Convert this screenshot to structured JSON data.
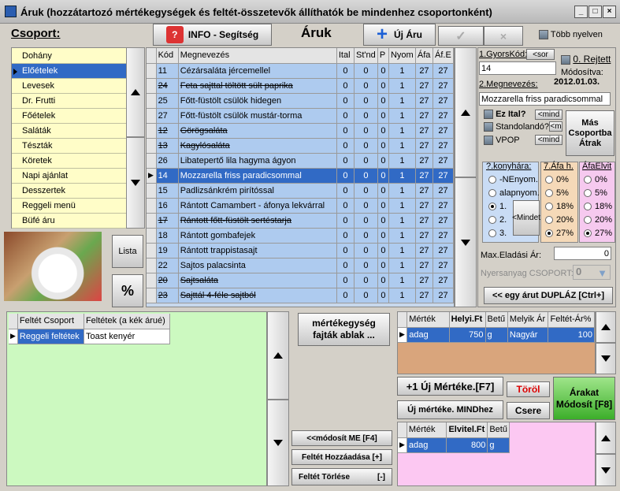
{
  "title": "Áruk (hozzátartozó mértékegységek és feltét-összetevők állíthatók be mindenhez csoportonként)",
  "groups_label": "Csoport:",
  "info_btn": "INFO - Segítség",
  "heading": "Áruk",
  "new_item_btn": "Új Áru",
  "multi_lang": "Több nyelven",
  "groups": [
    "Dohány",
    "Előételek",
    "Levesek",
    "Dr. Frutti",
    "Főételek",
    "Saláták",
    "Tészták",
    "Köretek",
    "Napi ajánlat",
    "Desszertek",
    "Reggeli menü",
    "Büfé áru"
  ],
  "selected_group": 1,
  "list_btn": "Lista",
  "percent_btn": "%",
  "items_headers": [
    "Kód",
    "Megnevezés",
    "Ital",
    "St'nd",
    "P",
    "Nyom",
    "Áfa",
    "Áf.E"
  ],
  "items": [
    {
      "kod": "11",
      "nev": "Cézársaláta jércemellel",
      "ital": "0",
      "stnd": "0",
      "p": "0",
      "nyom": "1",
      "afa": "27",
      "afe": "27",
      "strike": false
    },
    {
      "kod": "24",
      "nev": "Feta sajttal töltött sült paprika",
      "ital": "0",
      "stnd": "0",
      "p": "0",
      "nyom": "1",
      "afa": "27",
      "afe": "27",
      "strike": true
    },
    {
      "kod": "25",
      "nev": "Főtt-füstölt csülök hidegen",
      "ital": "0",
      "stnd": "0",
      "p": "0",
      "nyom": "1",
      "afa": "27",
      "afe": "27",
      "strike": false
    },
    {
      "kod": "27",
      "nev": "Főtt-füstölt csülök mustár-torma",
      "ital": "0",
      "stnd": "0",
      "p": "0",
      "nyom": "1",
      "afa": "27",
      "afe": "27",
      "strike": false
    },
    {
      "kod": "12",
      "nev": "Görögsaláta",
      "ital": "0",
      "stnd": "0",
      "p": "0",
      "nyom": "1",
      "afa": "27",
      "afe": "27",
      "strike": true
    },
    {
      "kod": "13",
      "nev": "Kagylósaláta",
      "ital": "0",
      "stnd": "0",
      "p": "0",
      "nyom": "1",
      "afa": "27",
      "afe": "27",
      "strike": true
    },
    {
      "kod": "26",
      "nev": "Libatepertő lila hagyma ágyon",
      "ital": "0",
      "stnd": "0",
      "p": "0",
      "nyom": "1",
      "afa": "27",
      "afe": "27",
      "strike": false
    },
    {
      "kod": "14",
      "nev": "Mozzarella friss paradicsommal",
      "ital": "0",
      "stnd": "0",
      "p": "0",
      "nyom": "1",
      "afa": "27",
      "afe": "27",
      "strike": false,
      "selected": true
    },
    {
      "kod": "15",
      "nev": "Padlizsánkrém pirítóssal",
      "ital": "0",
      "stnd": "0",
      "p": "0",
      "nyom": "1",
      "afa": "27",
      "afe": "27",
      "strike": false
    },
    {
      "kod": "16",
      "nev": "Rántott Camambert - áfonya lekvárral",
      "ital": "0",
      "stnd": "0",
      "p": "0",
      "nyom": "1",
      "afa": "27",
      "afe": "27",
      "strike": false
    },
    {
      "kod": "17",
      "nev": "Rántott főtt-füstölt sertéstarja",
      "ital": "0",
      "stnd": "0",
      "p": "0",
      "nyom": "1",
      "afa": "27",
      "afe": "27",
      "strike": true
    },
    {
      "kod": "18",
      "nev": "Rántott gombafejek",
      "ital": "0",
      "stnd": "0",
      "p": "0",
      "nyom": "1",
      "afa": "27",
      "afe": "27",
      "strike": false
    },
    {
      "kod": "19",
      "nev": "Rántott trappistasajt",
      "ital": "0",
      "stnd": "0",
      "p": "0",
      "nyom": "1",
      "afa": "27",
      "afe": "27",
      "strike": false
    },
    {
      "kod": "22",
      "nev": "Sajtos palacsinta",
      "ital": "0",
      "stnd": "0",
      "p": "0",
      "nyom": "1",
      "afa": "27",
      "afe": "27",
      "strike": false
    },
    {
      "kod": "20",
      "nev": "Sajtsaláta",
      "ital": "0",
      "stnd": "0",
      "p": "0",
      "nyom": "1",
      "afa": "27",
      "afe": "27",
      "strike": true
    },
    {
      "kod": "23",
      "nev": "Sajttál 4-féle sajtból",
      "ital": "0",
      "stnd": "0",
      "p": "0",
      "nyom": "1",
      "afa": "27",
      "afe": "27",
      "strike": true
    }
  ],
  "detail": {
    "quick_code_label": "1.GyorsKód:",
    "sor_btn": "<sor",
    "quick_code_value": "14",
    "rejected_label": "0. Rejtett",
    "modified_label": "Módosítva:",
    "modified_date": "2012.01.03.",
    "name_label": "2.Megnevezés:",
    "name_value": "Mozzarella friss paradicsommal",
    "ital_label": "Ez Ital?",
    "standolando_label": "Standolandó?",
    "vpop_label": "VPOP",
    "mind_btn": "<mind",
    "m_btn": "<m",
    "other_group_btn": "Más Csoportba Átrak",
    "kitchen_label": "?.konyhára:",
    "kitchen_opts": [
      "-NEnyom.",
      "alapnyom.",
      "1.",
      "2.",
      "3."
    ],
    "kitchen_selected": 2,
    "mindet_btn": "<Mindet",
    "afa_label": "7.Áfa h.",
    "afa_opts": [
      "0%",
      "5%",
      "18%",
      "20%",
      "27%"
    ],
    "afa_selected": 4,
    "afaelvit_label": "ÁfaElvit",
    "afaelvit_selected": 4,
    "max_price_label": "Max.Eladási Ár:",
    "max_price_value": "0",
    "raw_group_label": "Nyersanyag CSOPORT:",
    "raw_group_value": "0",
    "duplicate_btn": "<< egy árut DUPLÁZ [Ctrl+]"
  },
  "toppings": {
    "headers": [
      "Feltét Csoport",
      "Feltétek (a kék árué)"
    ],
    "rows": [
      {
        "group": "Reggeli feltétek",
        "item": "Toast kenyér"
      }
    ]
  },
  "units_window_btn": "mértékegység fajták ablak ...",
  "modify_me_btn": "<<módosít ME [F4]",
  "add_topping_btn": "Feltét Hozzáadása [+]",
  "delete_topping_btn": "Feltét Törlése",
  "delete_topping_key": "[-]",
  "units": {
    "headers": [
      "Mérték",
      "Helyi.Ft",
      "Betű",
      "Melyik Ár",
      "Feltét-Ár%"
    ],
    "rows": [
      {
        "m": "adag",
        "ft": "750",
        "b": "g",
        "which": "Nagyár",
        "pct": "100"
      }
    ]
  },
  "new_unit_btn": "+1 Új Mértéke.[F7]",
  "delete_btn": "Töröl",
  "prices_btn": "Árakat Módosít [F8]",
  "new_unit_all_btn": "Új mértéke. MINDhez",
  "swap_btn": "Csere",
  "takeaway": {
    "headers": [
      "Mérték",
      "Elvitel.Ft",
      "Betű"
    ],
    "rows": [
      {
        "m": "adag",
        "ft": "800",
        "b": "g"
      }
    ]
  }
}
